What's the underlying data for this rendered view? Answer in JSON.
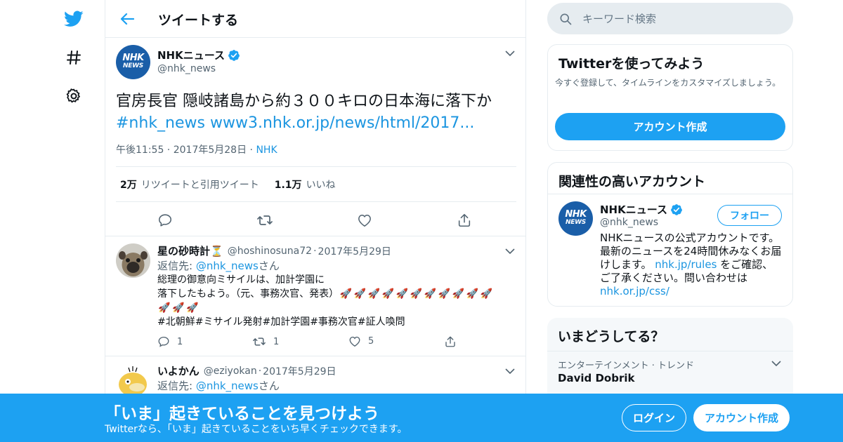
{
  "header": {
    "title": "ツイートする"
  },
  "tweet": {
    "author_name": "NHKニュース",
    "author_handle": "@nhk_news",
    "avatar_line1": "NHK",
    "avatar_line2": "NEWS",
    "text": "官房長官 隠岐諸島から約３００キロの日本海に落下か",
    "hashtag": "#nhk_news",
    "url": "www3.nhk.or.jp/news/html/2017...",
    "time": "午後11:55",
    "date": "2017年5月28日",
    "source": "NHK",
    "retweets_count": "2万",
    "retweets_label": "リツイートと引用ツイート",
    "likes_count": "1.1万",
    "likes_label": "いいね"
  },
  "replies": [
    {
      "name": "星の砂時計",
      "name_emoji": "⏳",
      "handle": "@hoshinosuna72",
      "date": "2017年5月29日",
      "reply_to_prefix": "返信先: ",
      "reply_to_handle": "@nhk_news",
      "reply_to_suffix": "さん",
      "line1": "総理の御意向ミサイルは、加計学園に",
      "line2": "落下したもよう。（元、事務次官、発表）",
      "line4": "#北朝鮮#ミサイル発射#加計学園#事務次官#証人喚問",
      "emoji_rocket": "🚀",
      "replies_count": "1",
      "retweets_count": "1",
      "likes_count": "5"
    },
    {
      "name": "いよかん",
      "handle": "@eziyokan",
      "date": "2017年5月29日",
      "reply_to_prefix": "返信先: ",
      "reply_to_handle": "@nhk_news",
      "reply_to_suffix": "さん"
    }
  ],
  "sidebar": {
    "search_placeholder": "キーワード検索",
    "signup": {
      "title": "Twitterを使ってみよう",
      "desc": "今すぐ登録して、タイムラインをカスタマイズしましょう。",
      "button": "アカウント作成"
    },
    "related": {
      "title": "関連性の高いアカウント",
      "name": "NHKニュース",
      "handle": "@nhk_news",
      "follow_label": "フォロー",
      "bio_1": "NHKニュースの公式アカウントです。最新のニュースを24時間休みなくお届けします。",
      "bio_link1": "nhk.jp/rules",
      "bio_2": " をご確認、ご了承ください。問い合わせは",
      "bio_link2": "nhk.or.jp/css/"
    },
    "trends": {
      "title": "いまどうしてる？",
      "category": "エンターテインメント · トレンド",
      "topic": "David Dobrik"
    }
  },
  "banner": {
    "title": "「いま」起きていることを見つけよう",
    "subtitle": "Twitterなら、「いま」起きていることをいち早くチェックできます。",
    "login": "ログイン",
    "signup": "アカウント作成"
  },
  "colors": {
    "brand": "#1da1f2",
    "link": "#1b95e0",
    "muted": "#536471",
    "border": "#e6ecf0"
  }
}
